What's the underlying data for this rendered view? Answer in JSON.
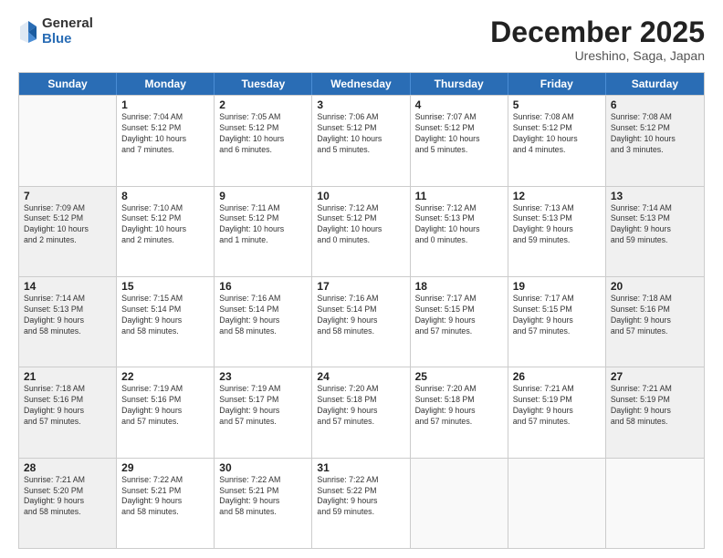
{
  "logo": {
    "general": "General",
    "blue": "Blue"
  },
  "title": "December 2025",
  "subtitle": "Ureshino, Saga, Japan",
  "header_days": [
    "Sunday",
    "Monday",
    "Tuesday",
    "Wednesday",
    "Thursday",
    "Friday",
    "Saturday"
  ],
  "weeks": [
    [
      {
        "day": "",
        "text": "",
        "empty": true
      },
      {
        "day": "1",
        "text": "Sunrise: 7:04 AM\nSunset: 5:12 PM\nDaylight: 10 hours\nand 7 minutes."
      },
      {
        "day": "2",
        "text": "Sunrise: 7:05 AM\nSunset: 5:12 PM\nDaylight: 10 hours\nand 6 minutes."
      },
      {
        "day": "3",
        "text": "Sunrise: 7:06 AM\nSunset: 5:12 PM\nDaylight: 10 hours\nand 5 minutes."
      },
      {
        "day": "4",
        "text": "Sunrise: 7:07 AM\nSunset: 5:12 PM\nDaylight: 10 hours\nand 5 minutes."
      },
      {
        "day": "5",
        "text": "Sunrise: 7:08 AM\nSunset: 5:12 PM\nDaylight: 10 hours\nand 4 minutes."
      },
      {
        "day": "6",
        "text": "Sunrise: 7:08 AM\nSunset: 5:12 PM\nDaylight: 10 hours\nand 3 minutes."
      }
    ],
    [
      {
        "day": "7",
        "text": "Sunrise: 7:09 AM\nSunset: 5:12 PM\nDaylight: 10 hours\nand 2 minutes."
      },
      {
        "day": "8",
        "text": "Sunrise: 7:10 AM\nSunset: 5:12 PM\nDaylight: 10 hours\nand 2 minutes."
      },
      {
        "day": "9",
        "text": "Sunrise: 7:11 AM\nSunset: 5:12 PM\nDaylight: 10 hours\nand 1 minute."
      },
      {
        "day": "10",
        "text": "Sunrise: 7:12 AM\nSunset: 5:12 PM\nDaylight: 10 hours\nand 0 minutes."
      },
      {
        "day": "11",
        "text": "Sunrise: 7:12 AM\nSunset: 5:13 PM\nDaylight: 10 hours\nand 0 minutes."
      },
      {
        "day": "12",
        "text": "Sunrise: 7:13 AM\nSunset: 5:13 PM\nDaylight: 9 hours\nand 59 minutes."
      },
      {
        "day": "13",
        "text": "Sunrise: 7:14 AM\nSunset: 5:13 PM\nDaylight: 9 hours\nand 59 minutes."
      }
    ],
    [
      {
        "day": "14",
        "text": "Sunrise: 7:14 AM\nSunset: 5:13 PM\nDaylight: 9 hours\nand 58 minutes."
      },
      {
        "day": "15",
        "text": "Sunrise: 7:15 AM\nSunset: 5:14 PM\nDaylight: 9 hours\nand 58 minutes."
      },
      {
        "day": "16",
        "text": "Sunrise: 7:16 AM\nSunset: 5:14 PM\nDaylight: 9 hours\nand 58 minutes."
      },
      {
        "day": "17",
        "text": "Sunrise: 7:16 AM\nSunset: 5:14 PM\nDaylight: 9 hours\nand 58 minutes."
      },
      {
        "day": "18",
        "text": "Sunrise: 7:17 AM\nSunset: 5:15 PM\nDaylight: 9 hours\nand 57 minutes."
      },
      {
        "day": "19",
        "text": "Sunrise: 7:17 AM\nSunset: 5:15 PM\nDaylight: 9 hours\nand 57 minutes."
      },
      {
        "day": "20",
        "text": "Sunrise: 7:18 AM\nSunset: 5:16 PM\nDaylight: 9 hours\nand 57 minutes."
      }
    ],
    [
      {
        "day": "21",
        "text": "Sunrise: 7:18 AM\nSunset: 5:16 PM\nDaylight: 9 hours\nand 57 minutes."
      },
      {
        "day": "22",
        "text": "Sunrise: 7:19 AM\nSunset: 5:16 PM\nDaylight: 9 hours\nand 57 minutes."
      },
      {
        "day": "23",
        "text": "Sunrise: 7:19 AM\nSunset: 5:17 PM\nDaylight: 9 hours\nand 57 minutes."
      },
      {
        "day": "24",
        "text": "Sunrise: 7:20 AM\nSunset: 5:18 PM\nDaylight: 9 hours\nand 57 minutes."
      },
      {
        "day": "25",
        "text": "Sunrise: 7:20 AM\nSunset: 5:18 PM\nDaylight: 9 hours\nand 57 minutes."
      },
      {
        "day": "26",
        "text": "Sunrise: 7:21 AM\nSunset: 5:19 PM\nDaylight: 9 hours\nand 57 minutes."
      },
      {
        "day": "27",
        "text": "Sunrise: 7:21 AM\nSunset: 5:19 PM\nDaylight: 9 hours\nand 58 minutes."
      }
    ],
    [
      {
        "day": "28",
        "text": "Sunrise: 7:21 AM\nSunset: 5:20 PM\nDaylight: 9 hours\nand 58 minutes."
      },
      {
        "day": "29",
        "text": "Sunrise: 7:22 AM\nSunset: 5:21 PM\nDaylight: 9 hours\nand 58 minutes."
      },
      {
        "day": "30",
        "text": "Sunrise: 7:22 AM\nSunset: 5:21 PM\nDaylight: 9 hours\nand 58 minutes."
      },
      {
        "day": "31",
        "text": "Sunrise: 7:22 AM\nSunset: 5:22 PM\nDaylight: 9 hours\nand 59 minutes."
      },
      {
        "day": "",
        "text": "",
        "empty": true
      },
      {
        "day": "",
        "text": "",
        "empty": true
      },
      {
        "day": "",
        "text": "",
        "empty": true
      }
    ]
  ]
}
